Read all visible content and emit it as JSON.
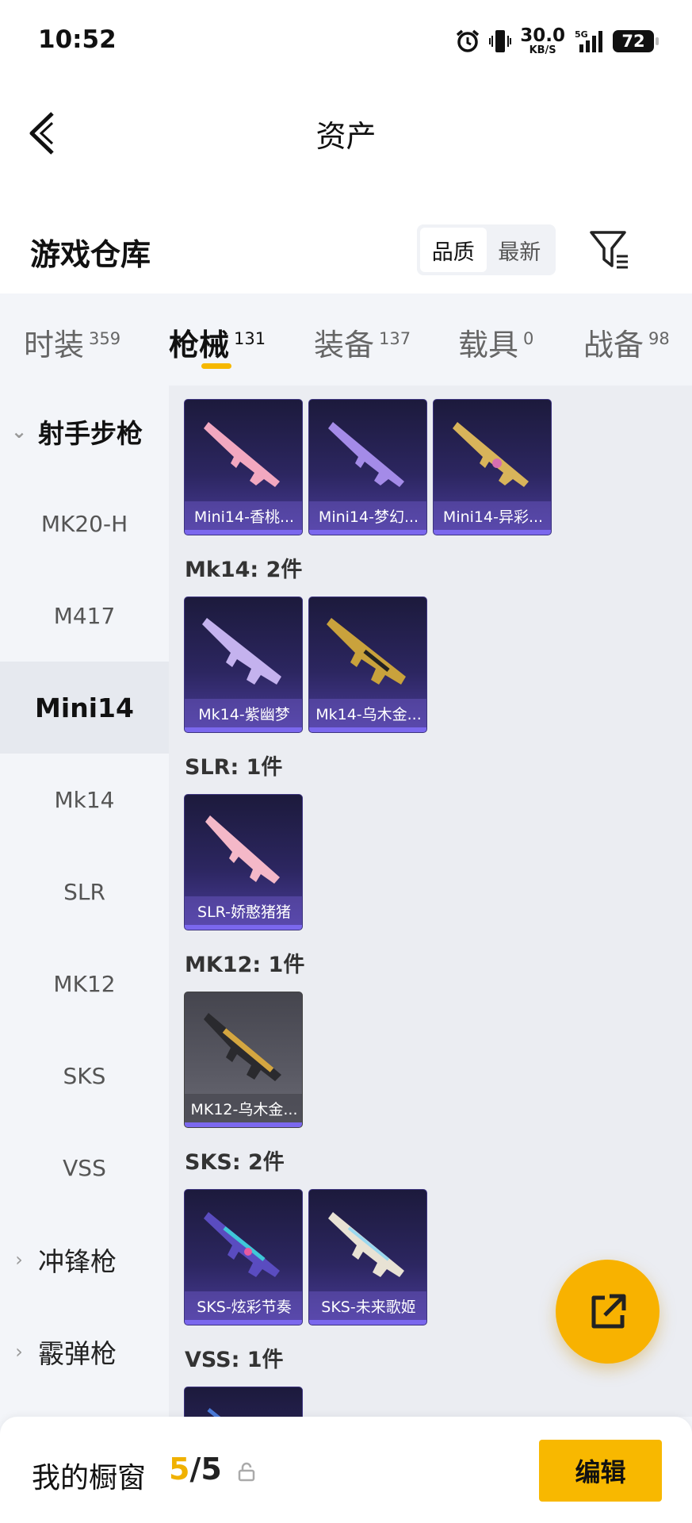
{
  "status_bar": {
    "time": "10:52",
    "net_speed_value": "30.0",
    "net_speed_unit": "KB/S",
    "network": "5G",
    "battery": "72"
  },
  "header": {
    "title": "资产",
    "back_icon": "chevron-left-icon"
  },
  "section": {
    "title": "游戏仓库",
    "sort_options": [
      "品质",
      "最新"
    ],
    "sort_selected": "品质",
    "filter_icon": "filter-icon"
  },
  "tabs": [
    {
      "label": "时装",
      "count": "359"
    },
    {
      "label": "枪械",
      "count": "131",
      "active": true
    },
    {
      "label": "装备",
      "count": "137"
    },
    {
      "label": "载具",
      "count": "0"
    },
    {
      "label": "战备",
      "count": "98"
    }
  ],
  "sidebar": {
    "group_open": "射手步枪",
    "items": [
      "MK20-H",
      "M417",
      "Mini14",
      "Mk14",
      "SLR",
      "MK12",
      "SKS",
      "VSS"
    ],
    "selected": "Mini14",
    "groups_closed": [
      "冲锋枪",
      "霰弹枪"
    ]
  },
  "categories": [
    {
      "title": "",
      "items": [
        "Mini14-香桃...",
        "Mini14-梦幻...",
        "Mini14-异彩..."
      ]
    },
    {
      "title": "Mk14: 2件",
      "items": [
        "Mk14-紫幽梦",
        "Mk14-乌木金..."
      ]
    },
    {
      "title": "SLR: 1件",
      "items": [
        "SLR-娇憨猪猪"
      ]
    },
    {
      "title": "MK12: 1件",
      "items": [
        "MK12-乌木金..."
      ]
    },
    {
      "title": "SKS: 2件",
      "items": [
        "SKS-炫彩节奏",
        "SKS-未来歌姬"
      ]
    },
    {
      "title": "VSS: 1件",
      "items": [
        ""
      ]
    }
  ],
  "fab": {
    "icon": "share-external-icon"
  },
  "bottom_bar": {
    "label": "我的橱窗",
    "count_current": "5",
    "count_total": "/5",
    "lock_icon": "lock-icon",
    "edit_label": "编辑"
  },
  "colors": {
    "accent": "#f8b800",
    "card_purple": "#2c2660",
    "card_grey": "#5a5a64"
  }
}
